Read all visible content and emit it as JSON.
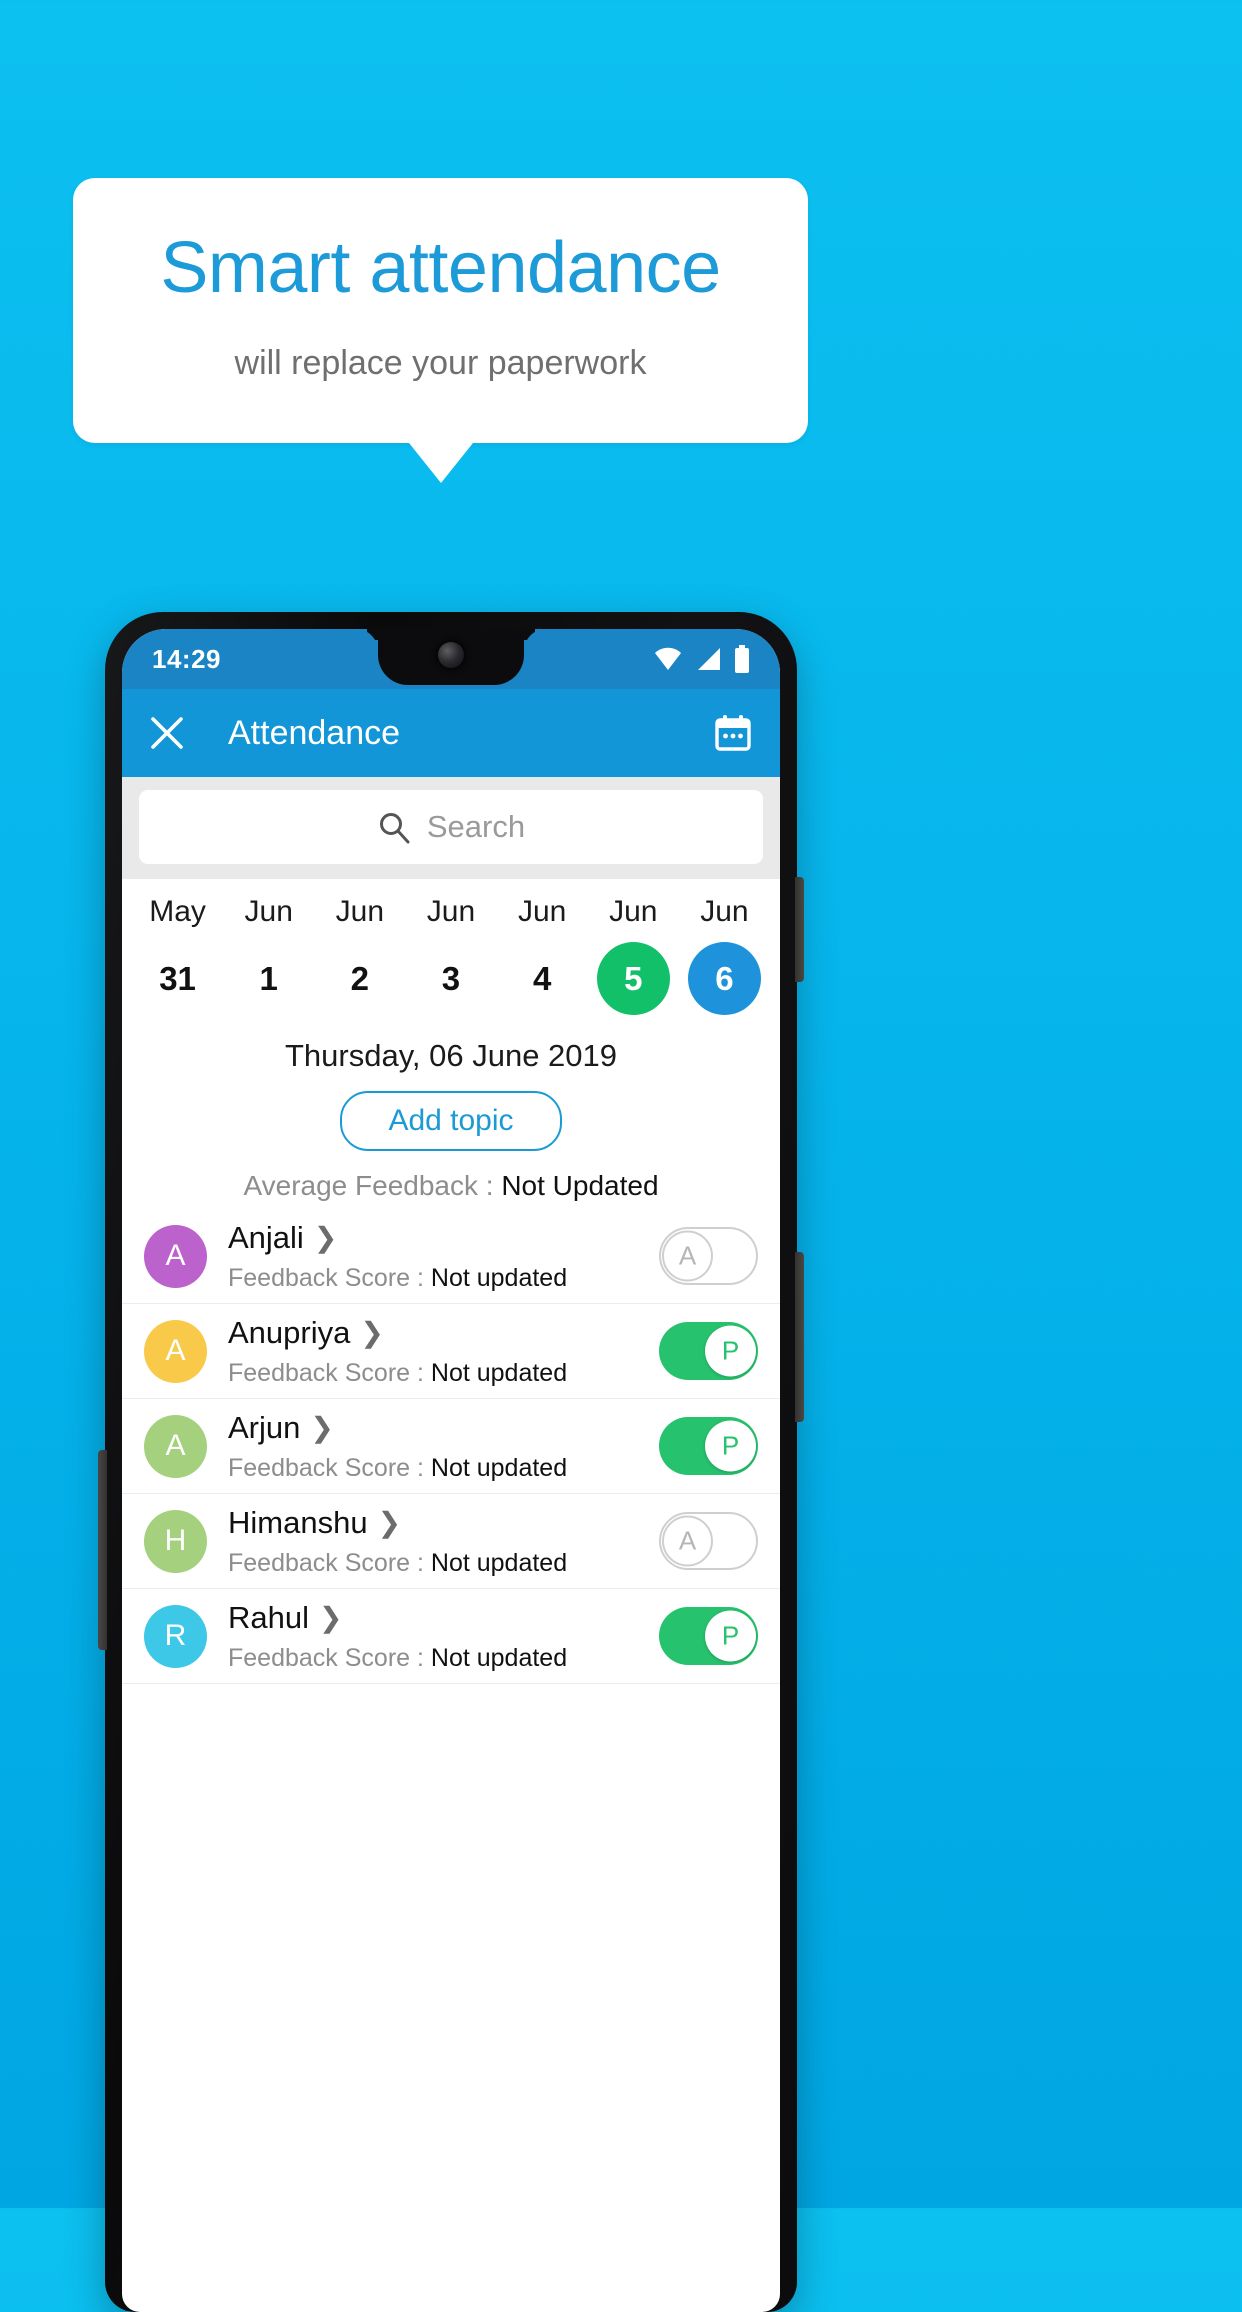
{
  "promo": {
    "title": "Smart attendance",
    "subtitle": "will replace your paperwork"
  },
  "colors": {
    "background_top": "#0cc0f0",
    "background_bottom": "#00a6e2",
    "brand_blue": "#1296d8",
    "title_blue": "#1d9bd8",
    "present_green": "#26c26d",
    "selected_green": "#13c06a",
    "selected_blue": "#1e93dc"
  },
  "phone": {
    "statusbar": {
      "time": "14:29",
      "icons": [
        "wifi-icon",
        "signal-icon",
        "battery-icon"
      ]
    },
    "appbar": {
      "close_icon": "close-icon",
      "title": "Attendance",
      "calendar_icon": "calendar-icon"
    },
    "search": {
      "icon": "search-icon",
      "placeholder": "Search",
      "value": ""
    },
    "date_strip": [
      {
        "month": "May",
        "day": "31",
        "state": "normal"
      },
      {
        "month": "Jun",
        "day": "1",
        "state": "normal"
      },
      {
        "month": "Jun",
        "day": "2",
        "state": "normal"
      },
      {
        "month": "Jun",
        "day": "3",
        "state": "normal"
      },
      {
        "month": "Jun",
        "day": "4",
        "state": "normal"
      },
      {
        "month": "Jun",
        "day": "5",
        "state": "green"
      },
      {
        "month": "Jun",
        "day": "6",
        "state": "blue"
      }
    ],
    "selected_date_label": "Thursday, 06 June 2019",
    "add_topic_label": "Add topic",
    "average_feedback": {
      "label": "Average Feedback : ",
      "value": "Not Updated"
    },
    "feedback_label": "Feedback Score : ",
    "students": [
      {
        "name": "Anjali",
        "initial": "A",
        "avatar_color": "#bb62cc",
        "feedback_value": "Not updated",
        "attendance": "A",
        "present": false
      },
      {
        "name": "Anupriya",
        "initial": "A",
        "avatar_color": "#f9ca4a",
        "feedback_value": "Not updated",
        "attendance": "P",
        "present": true
      },
      {
        "name": "Arjun",
        "initial": "A",
        "avatar_color": "#a5d07e",
        "feedback_value": "Not updated",
        "attendance": "P",
        "present": true
      },
      {
        "name": "Himanshu",
        "initial": "H",
        "avatar_color": "#a5d07e",
        "feedback_value": "Not updated",
        "attendance": "A",
        "present": false
      },
      {
        "name": "Rahul",
        "initial": "R",
        "avatar_color": "#3dc8e8",
        "feedback_value": "Not updated",
        "attendance": "P",
        "present": true
      }
    ]
  }
}
